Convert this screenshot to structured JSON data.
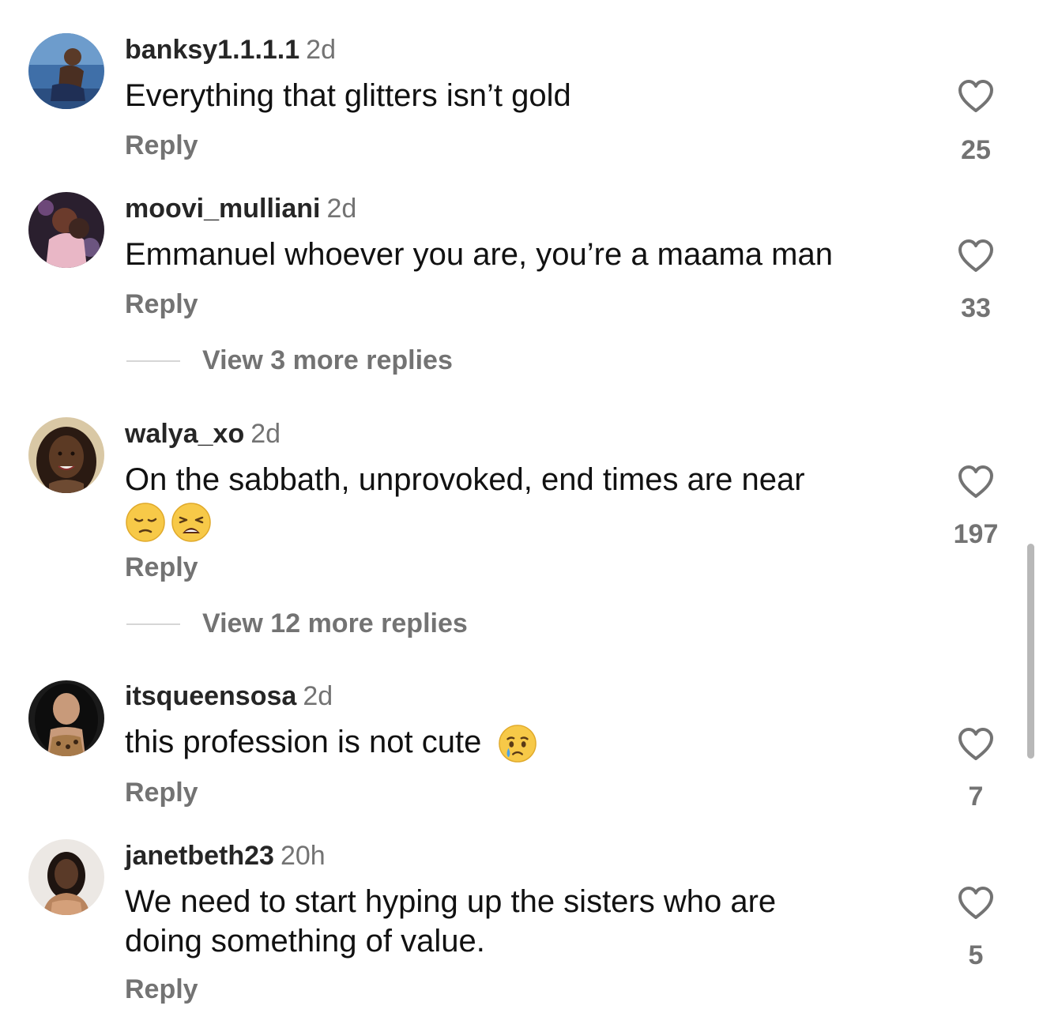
{
  "comments": [
    {
      "username": "banksy1.1.1.1",
      "time": "2d",
      "text": "Everything that glitters isn’t gold",
      "reply_label": "Reply",
      "likes": "25"
    },
    {
      "username": "moovi_mulliani",
      "time": "2d",
      "text": "Emmanuel whoever you are, you’re a maama man",
      "reply_label": "Reply",
      "likes": "33",
      "view_replies": "View 3 more replies"
    },
    {
      "username": "walya_xo",
      "time": "2d",
      "text": "On the sabbath, unprovoked, end times are near",
      "emojis": [
        "pensive-face-emoji",
        "weary-face-emoji"
      ],
      "reply_label": "Reply",
      "likes": "197",
      "view_replies": "View 12 more replies"
    },
    {
      "username": "itsqueensosa",
      "time": "2d",
      "text": "this profession is not cute",
      "emojis": [
        "crying-face-emoji"
      ],
      "reply_label": "Reply",
      "likes": "7"
    },
    {
      "username": "janetbeth23",
      "time": "20h",
      "text": "We need to start hyping up the sisters who are doing something of value.",
      "reply_label": "Reply",
      "likes": "5"
    }
  ],
  "icons": {
    "like": "heart-outline-icon"
  },
  "colors": {
    "username": "#262626",
    "secondary_text": "#737373",
    "body_text": "#111111",
    "divider": "#d6d6d6",
    "scrollbar": "#b8b8b8"
  }
}
